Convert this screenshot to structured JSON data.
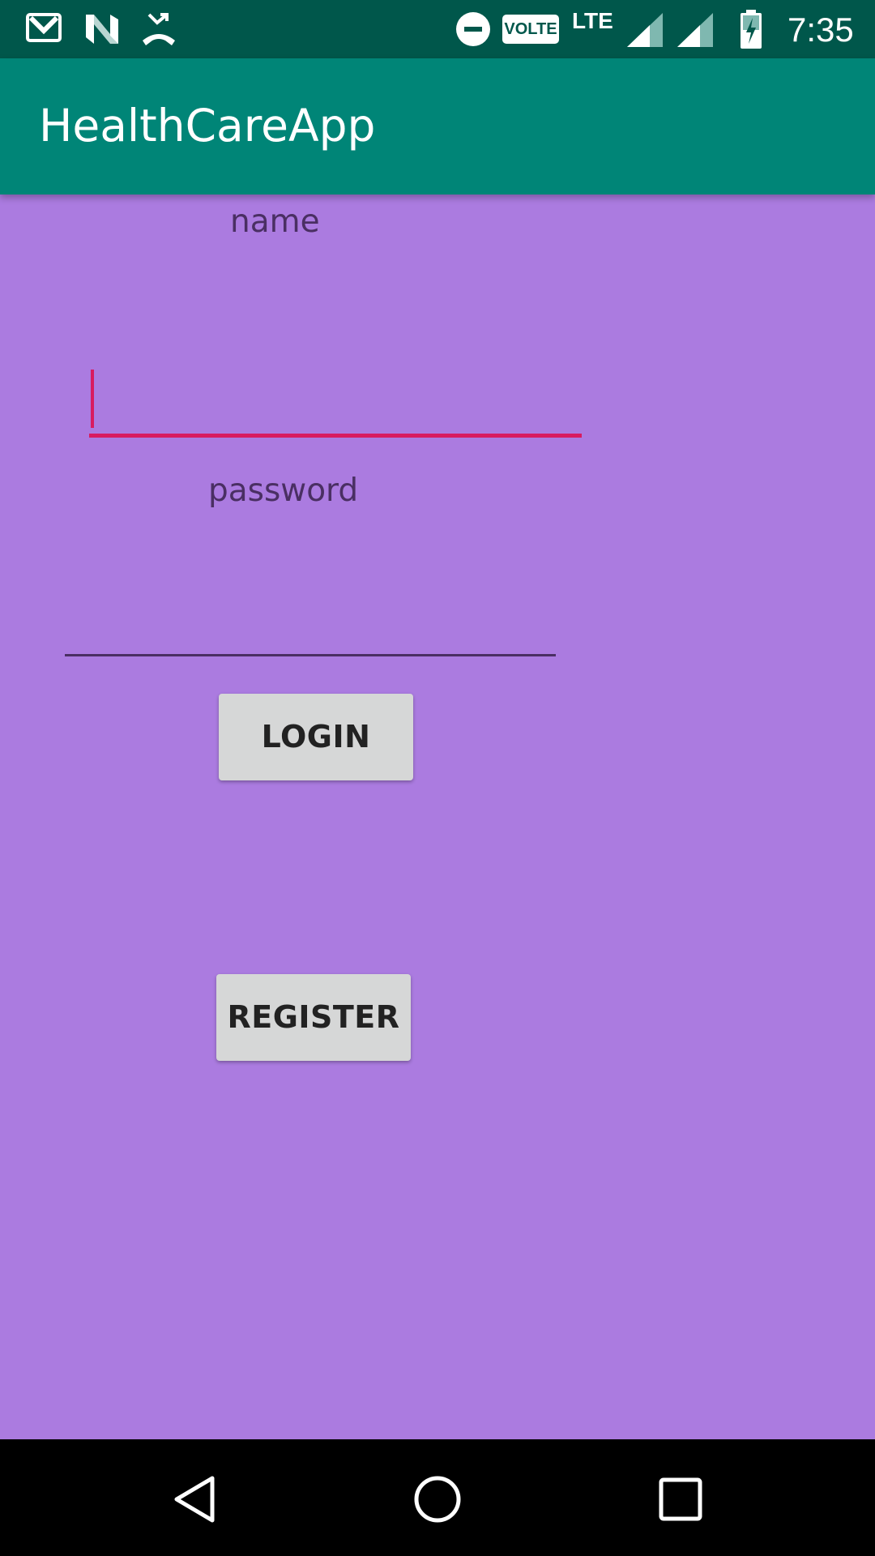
{
  "status_bar": {
    "time": "7:35",
    "network": "LTE",
    "volte_badge": "VOLTE",
    "left_icons": [
      "gmail-icon",
      "n-icon",
      "missed-call-icon"
    ],
    "right_icons": [
      "do-not-disturb-icon",
      "volte-icon",
      "signal-icon",
      "signal-icon",
      "battery-charging-icon"
    ]
  },
  "app_bar": {
    "title": "HealthCareApp"
  },
  "form": {
    "name_label": "name",
    "name_value": "",
    "password_label": "password",
    "password_value": "",
    "login_button": "LOGIN",
    "register_button": "REGISTER"
  },
  "nav_bar": {
    "buttons": [
      "back-icon",
      "home-icon",
      "recents-icon"
    ]
  },
  "colors": {
    "status_bar": "#00574b",
    "app_bar": "#008577",
    "background": "#ab7be0",
    "accent": "#d81b60",
    "button": "#d6d7d7",
    "label": "#4a2f63"
  }
}
